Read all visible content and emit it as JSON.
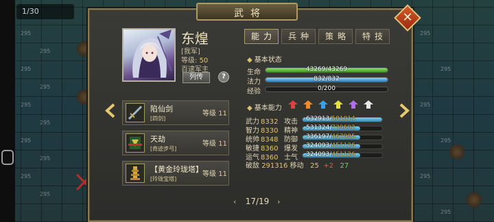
{
  "window": {
    "counter": "1/30",
    "bg_number": "295"
  },
  "panel": {
    "title": "武将"
  },
  "general": {
    "name": "东煌",
    "faction": "[我军]",
    "level_label": "等级:",
    "level_value": "50",
    "role": "百逮军主",
    "bio_label": "列传",
    "help_label": "?"
  },
  "equipment": [
    {
      "name": "陷仙剑",
      "type": "[四剑]",
      "level_label": "等级",
      "level": "11",
      "icon": "sword-icon"
    },
    {
      "name": "天劫",
      "type": "[奇迹步弓]",
      "level_label": "等级",
      "level": "11",
      "icon": "rune-icon"
    },
    {
      "name": "【黄金玲珑塔】",
      "type": "[玲珑宝塔]",
      "level_label": "等级",
      "level": "11",
      "icon": "pagoda-icon"
    }
  ],
  "tabs": [
    {
      "label": "能力",
      "active": true
    },
    {
      "label": "兵种",
      "active": false
    },
    {
      "label": "策略",
      "active": false
    },
    {
      "label": "特技",
      "active": false
    }
  ],
  "basic": {
    "header": "基本状态",
    "hp_label": "生命",
    "hp": "43269/43269",
    "hp_fraction": 1.0,
    "mp_label": "法力",
    "mp": "832/832",
    "mp_fraction": 1.0,
    "exp_label": "经验",
    "exp": "0/200",
    "exp_fraction": 0.0
  },
  "ability": {
    "header": "基本能力",
    "arrow_colors": [
      "#e04040",
      "#f08a2a",
      "#3aa0e8",
      "#e8e040",
      "#b070e0",
      "#e8e8e8"
    ],
    "rows": [
      {
        "attr": "武力",
        "value": "8332",
        "sub": "攻击",
        "cur": "632913",
        "max": "581014",
        "fill": 1.0
      },
      {
        "attr": "智力",
        "value": "8330",
        "sub": "精神",
        "cur": "531324",
        "max": "739602",
        "fill": 0.72
      },
      {
        "attr": "统帅",
        "value": "8348",
        "sub": "防御",
        "cur": "336197",
        "max": "467985",
        "fill": 0.72
      },
      {
        "attr": "敏捷",
        "value": "8360",
        "sub": "爆发",
        "cur": "324093",
        "max": "451126",
        "fill": 0.72
      },
      {
        "attr": "运气",
        "value": "8360",
        "sub": "士气",
        "cur": "324093",
        "max": "451126",
        "fill": 0.72
      }
    ],
    "break_label": "破敌",
    "break_value": "291316",
    "move_label": "移动",
    "move_value": "25",
    "move_plus": "+2",
    "move_total": "27"
  },
  "pager": {
    "text": "17/19",
    "prev": "‹",
    "next": "›"
  }
}
